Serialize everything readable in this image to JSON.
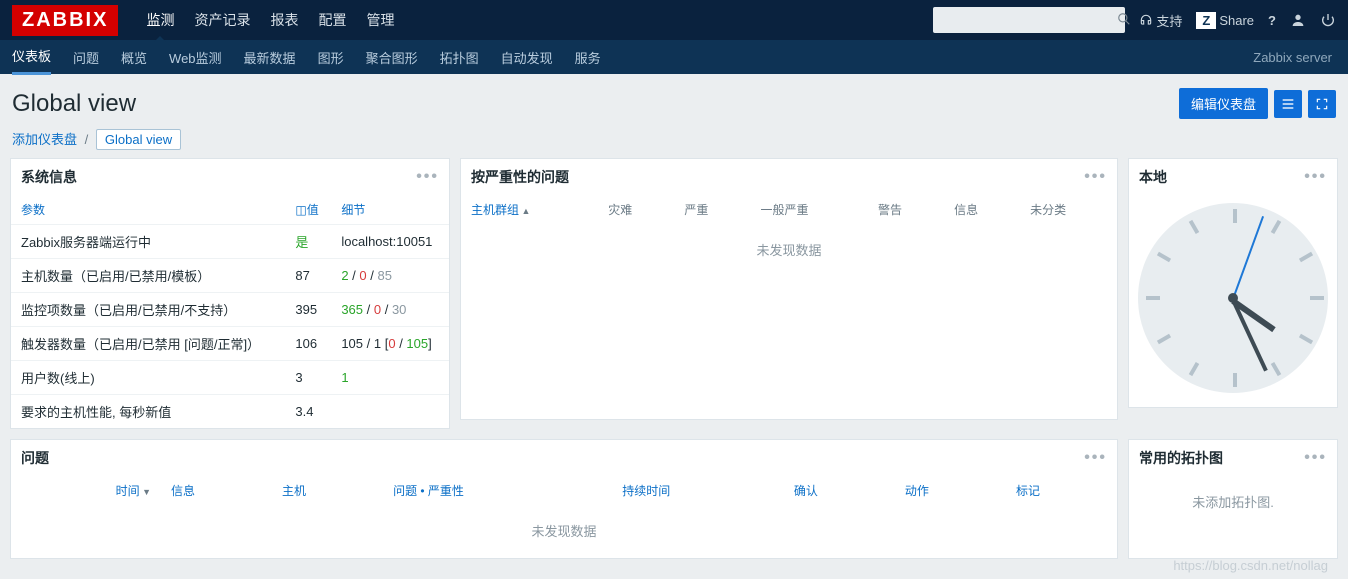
{
  "logo": "ZABBIX",
  "topnav": [
    "监测",
    "资产记录",
    "报表",
    "配置",
    "管理"
  ],
  "topnav_active": 0,
  "search_placeholder": "",
  "support_label": "支持",
  "share_label": "Share",
  "share_prefix": "Z",
  "subnav": [
    "仪表板",
    "问题",
    "概览",
    "Web监测",
    "最新数据",
    "图形",
    "聚合图形",
    "拓扑图",
    "自动发现",
    "服务"
  ],
  "subnav_active": 0,
  "server_label": "Zabbix server",
  "page_title": "Global view",
  "btn_edit": "编辑仪表盘",
  "breadcrumb": {
    "add": "添加仪表盘",
    "current": "Global view"
  },
  "sysinfo": {
    "title": "系统信息",
    "headers": [
      "参数",
      "值",
      "细节"
    ],
    "val_hdr_prefix": "◫",
    "rows": [
      {
        "p": "Zabbix服务器端运行中",
        "v": {
          "text": "是",
          "cls": "green"
        },
        "d": [
          {
            "t": "localhost:10051"
          }
        ]
      },
      {
        "p": "主机数量（已启用/已禁用/模板）",
        "v": {
          "text": "87"
        },
        "d": [
          {
            "t": "2",
            "cls": "green"
          },
          {
            "t": " / "
          },
          {
            "t": "0",
            "cls": "red"
          },
          {
            "t": " / "
          },
          {
            "t": "85",
            "cls": "gray"
          }
        ]
      },
      {
        "p": "监控项数量（已启用/已禁用/不支持）",
        "v": {
          "text": "395"
        },
        "d": [
          {
            "t": "365",
            "cls": "green"
          },
          {
            "t": " / "
          },
          {
            "t": "0",
            "cls": "red"
          },
          {
            "t": " / "
          },
          {
            "t": "30",
            "cls": "gray"
          }
        ]
      },
      {
        "p": "触发器数量（已启用/已禁用 [问题/正常]）",
        "v": {
          "text": "106"
        },
        "d": [
          {
            "t": "105"
          },
          {
            "t": " / "
          },
          {
            "t": "1 ["
          },
          {
            "t": "0",
            "cls": "red"
          },
          {
            "t": " / "
          },
          {
            "t": "105",
            "cls": "green"
          },
          {
            "t": "]"
          }
        ]
      },
      {
        "p": "用户数(线上)",
        "v": {
          "text": "3"
        },
        "d": [
          {
            "t": "1",
            "cls": "green"
          }
        ]
      },
      {
        "p": "要求的主机性能, 每秒新值",
        "v": {
          "text": "3.4"
        },
        "d": []
      }
    ]
  },
  "severity": {
    "title": "按严重性的问题",
    "headers": [
      "主机群组",
      "灾难",
      "严重",
      "一般严重",
      "警告",
      "信息",
      "未分类"
    ],
    "nodata": "未发现数据"
  },
  "clock": {
    "title": "本地"
  },
  "problems": {
    "title": "问题",
    "headers": [
      "时间",
      "信息",
      "主机",
      "问题 • 严重性",
      "持续时间",
      "确认",
      "动作",
      "标记"
    ],
    "nodata": "未发现数据"
  },
  "maps": {
    "title": "常用的拓扑图",
    "empty": "未添加拓扑图."
  },
  "watermark": "https://blog.csdn.net/nollag"
}
